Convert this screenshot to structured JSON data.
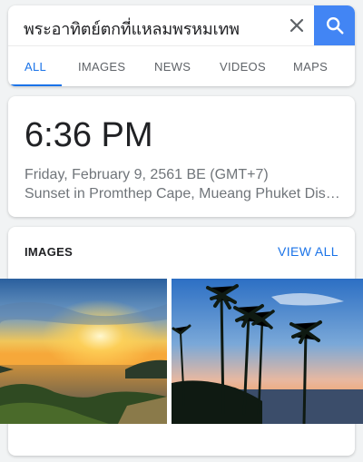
{
  "search": {
    "query": "พระอาทิตย์ตกที่แหลมพรหมเทพ"
  },
  "tabs": [
    "ALL",
    "IMAGES",
    "NEWS",
    "VIDEOS",
    "MAPS"
  ],
  "time_card": {
    "time": "6:36 PM",
    "date": "Friday, February 9, 2561 BE (GMT+7)",
    "place": "Sunset in Promthep Cape, Mueang Phuket District, Phuket"
  },
  "images_card": {
    "heading": "IMAGES",
    "view_all": "VIEW ALL"
  },
  "colors": {
    "accent": "#1a73e8",
    "search_button": "#4285f4",
    "background": "#f1f3f4"
  },
  "icons": {
    "clear": "close-icon",
    "search": "search-icon"
  }
}
